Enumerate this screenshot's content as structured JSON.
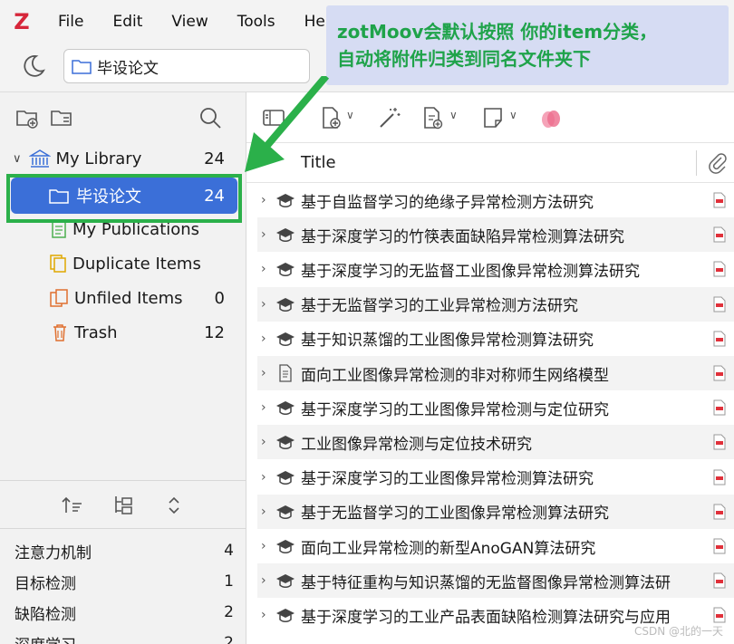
{
  "menubar": {
    "logo": "Z",
    "items": [
      "File",
      "Edit",
      "View",
      "Tools",
      "Help"
    ]
  },
  "tab": {
    "label": "毕设论文"
  },
  "callout": {
    "line1": "zotMoov会默认按照 你的item分类，",
    "line2": "自动将附件归类到同名文件夹下"
  },
  "tree": {
    "library": {
      "label": "My Library",
      "count": "24"
    },
    "selected": {
      "label": "毕设论文",
      "count": "24"
    },
    "items": [
      {
        "label": "My Publications",
        "count": ""
      },
      {
        "label": "Duplicate Items",
        "count": ""
      },
      {
        "label": "Unfiled Items",
        "count": "0"
      },
      {
        "label": "Trash",
        "count": "12"
      }
    ]
  },
  "tags": [
    {
      "label": "注意力机制",
      "count": "4"
    },
    {
      "label": "目标检测",
      "count": "1"
    },
    {
      "label": "缺陷检测",
      "count": "2"
    },
    {
      "label": "深度学习",
      "count": "2"
    }
  ],
  "items_pane": {
    "column_title": "Title",
    "rows": [
      {
        "title": "基于自监督学习的绝缘子异常检测方法研究",
        "type": "thesis"
      },
      {
        "title": "基于深度学习的竹筷表面缺陷异常检测算法研究",
        "type": "thesis"
      },
      {
        "title": "基于深度学习的无监督工业图像异常检测算法研究",
        "type": "thesis"
      },
      {
        "title": "基于无监督学习的工业异常检测方法研究",
        "type": "thesis"
      },
      {
        "title": "基于知识蒸馏的工业图像异常检测算法研究",
        "type": "thesis"
      },
      {
        "title": "面向工业图像异常检测的非对称师生网络模型",
        "type": "document"
      },
      {
        "title": "基于深度学习的工业图像异常检测与定位研究",
        "type": "thesis"
      },
      {
        "title": "工业图像异常检测与定位技术研究",
        "type": "thesis"
      },
      {
        "title": "基于深度学习的工业图像异常检测算法研究",
        "type": "thesis"
      },
      {
        "title": "基于无监督学习的工业图像异常检测算法研究",
        "type": "thesis"
      },
      {
        "title": "面向工业异常检测的新型AnoGAN算法研究",
        "type": "thesis"
      },
      {
        "title": "基于特征重构与知识蒸馏的无监督图像异常检测算法研",
        "type": "thesis"
      },
      {
        "title": "基于深度学习的工业产品表面缺陷检测算法研究与应用",
        "type": "thesis"
      }
    ]
  },
  "watermark": "CSDN @北的一天",
  "colors": {
    "accent": "#3b6fd8",
    "highlight": "#2bb04a",
    "callout_text": "#1fa34a",
    "logo": "#d6263a"
  }
}
